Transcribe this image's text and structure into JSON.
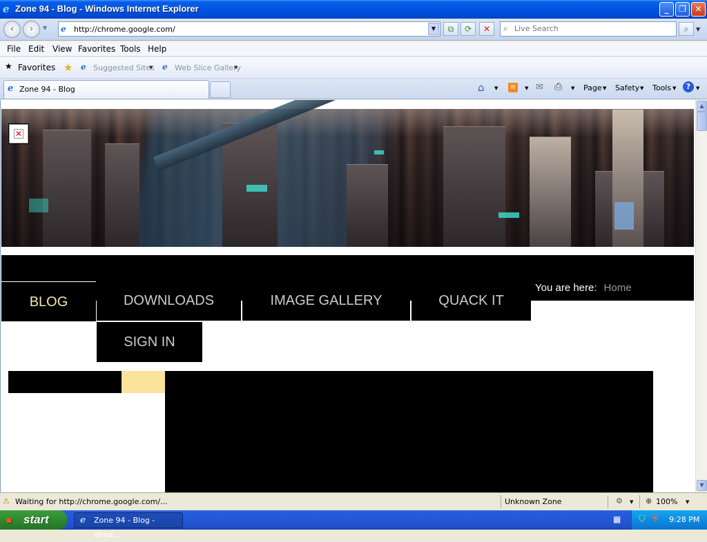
{
  "window": {
    "title": "Zone 94 - Blog - Windows Internet Explorer"
  },
  "address_bar": {
    "url": "http://chrome.google.com/"
  },
  "search": {
    "placeholder": "Live Search"
  },
  "menu": [
    "File",
    "Edit",
    "View",
    "Favorites",
    "Tools",
    "Help"
  ],
  "favorites_bar": {
    "favorites_label": "Favorites",
    "suggested_sites": "Suggested Sites",
    "web_slice_gallery": "Web Slice Gallery"
  },
  "tab": {
    "title": "Zone 94 - Blog"
  },
  "command_bar": {
    "page": "Page",
    "safety": "Safety",
    "tools": "Tools"
  },
  "site": {
    "nav": [
      "BLOG",
      "DOWNLOADS",
      "IMAGE GALLERY",
      "QUACK IT",
      "SIGN IN"
    ],
    "breadcrumb_label": "You are here:",
    "breadcrumb_home": "Home",
    "colors": {
      "nav_bg": "#000000",
      "active_tab_text": "#f3e6b4",
      "accent": "#fbe39a"
    }
  },
  "status_bar": {
    "message": "Waiting for http://chrome.google.com/...",
    "zone": "Unknown Zone",
    "zoom": "100%"
  },
  "taskbar": {
    "start_label": "start",
    "task_item": "Zone 94 - Blog - Wind...",
    "clock": "9:28 PM"
  }
}
